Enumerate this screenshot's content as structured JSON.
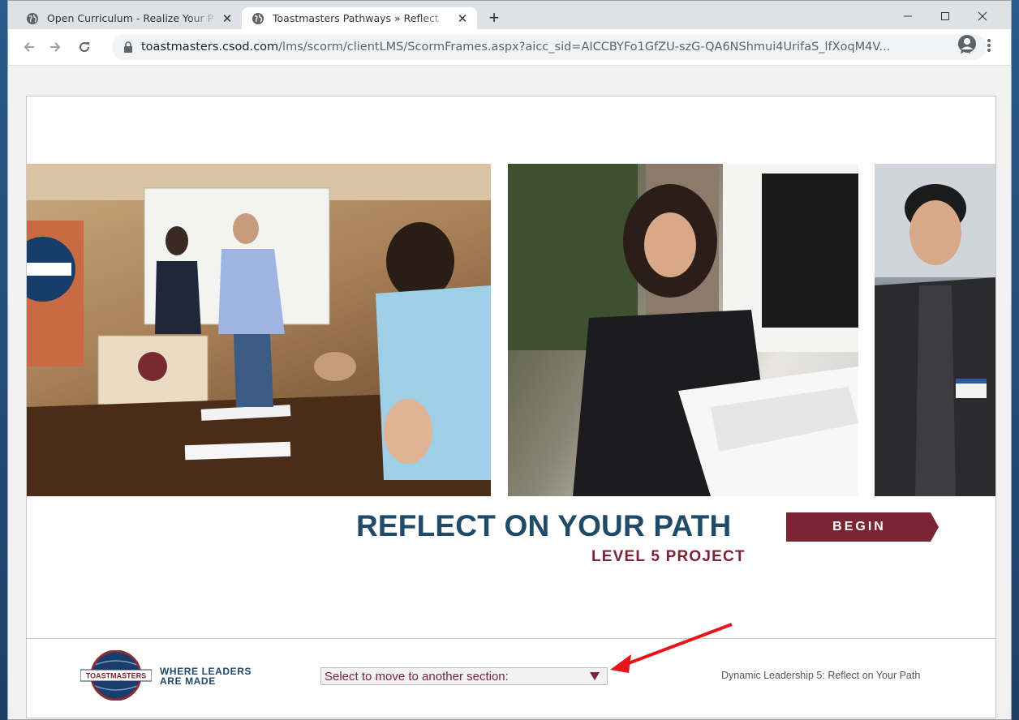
{
  "browser": {
    "tabs": [
      {
        "title": "Open Curriculum - Realize Your P",
        "active": false
      },
      {
        "title": "Toastmasters Pathways » Reflect",
        "active": true
      }
    ],
    "new_tab_label": "+",
    "window_controls": {
      "minimize": "–",
      "maximize": "☐",
      "close": "✕"
    },
    "url_host": "toastmasters.csod.com",
    "url_path": "/lms/scorm/clientLMS/ScormFrames.aspx?aicc_sid=AICCBYFo1GfZU-szG-QA6NShmui4UrifaS_lfXoqM4V..."
  },
  "course": {
    "headline": "REFLECT ON YOUR PATH",
    "begin_label": "BEGIN",
    "subheadline": "LEVEL 5 PROJECT",
    "footer": {
      "tagline_line1": "WHERE LEADERS",
      "tagline_line2": "ARE MADE",
      "logo_text": "TOASTMASTERS",
      "section_select": {
        "value": "Select to move to another section:"
      },
      "breadcrumb": "Dynamic Leadership 5: Reflect on Your Path"
    },
    "photos": [
      "handshake-meeting-photo",
      "woman-laptop-photo",
      "man-portrait-photo"
    ]
  },
  "colors": {
    "brand_blue": "#1f4a68",
    "brand_maroon": "#7b2433",
    "annotation_red": "#e8141c"
  }
}
